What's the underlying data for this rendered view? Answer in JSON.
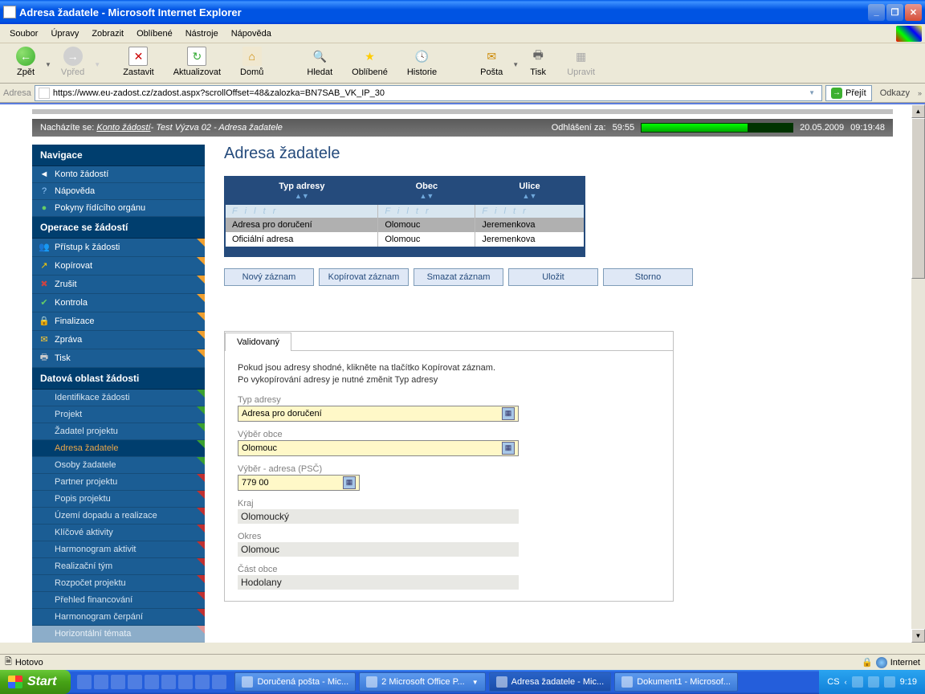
{
  "window": {
    "title": "Adresa žadatele - Microsoft Internet Explorer"
  },
  "menu": {
    "items": [
      "Soubor",
      "Úpravy",
      "Zobrazit",
      "Oblíbené",
      "Nástroje",
      "Nápověda"
    ]
  },
  "toolbar": {
    "back": "Zpět",
    "forward": "Vpřed",
    "stop": "Zastavit",
    "refresh": "Aktualizovat",
    "home": "Domů",
    "search": "Hledat",
    "favorites": "Oblíbené",
    "history": "Historie",
    "mail": "Pošta",
    "print": "Tisk",
    "edit": "Upravit"
  },
  "addressbar": {
    "label": "Adresa",
    "url": "https://www.eu-zadost.cz/zadost.aspx?scrollOffset=48&zalozka=BN7SAB_VK_IP_30",
    "go": "Přejít",
    "links": "Odkazy"
  },
  "breadcrumb": {
    "prefix": "Nacházíte se:",
    "link": "Konto žádostí",
    "trail": " - Test Výzva 02 - Adresa žadatele",
    "logout_label": "Odhlášení za:",
    "logout_time": "59:55",
    "date": "20.05.2009",
    "time": "09:19:48"
  },
  "sidebar": {
    "nav_header": "Navigace",
    "nav_items": [
      "Konto žádostí",
      "Nápověda",
      "Pokyny řídícího orgánu"
    ],
    "ops_header": "Operace se žádostí",
    "ops_items": [
      "Přístup k žádosti",
      "Kopírovat",
      "Zrušit",
      "Kontrola",
      "Finalizace",
      "Zpráva",
      "Tisk"
    ],
    "data_header": "Datová oblast žádosti",
    "data_items": [
      "Identifikace žádosti",
      "Projekt",
      "Žadatel projektu",
      "Adresa žadatele",
      "Osoby žadatele",
      "Partner projektu",
      "Popis projektu",
      "Území dopadu a realizace",
      "Klíčové aktivity",
      "Harmonogram aktivit",
      "Realizační tým",
      "Rozpočet projektu",
      "Přehled financování",
      "Harmonogram čerpání",
      "Horizontální témata"
    ]
  },
  "page": {
    "title": "Adresa žadatele",
    "table": {
      "headers": [
        "Typ adresy",
        "Obec",
        "Ulice"
      ],
      "filter": "F i l t r",
      "rows": [
        {
          "typ": "Adresa pro doručení",
          "obec": "Olomouc",
          "ulice": "Jeremenkova"
        },
        {
          "typ": "Oficiální adresa",
          "obec": "Olomouc",
          "ulice": "Jeremenkova"
        }
      ]
    },
    "buttons": {
      "novy": "Nový záznam",
      "kopirovat": "Kopírovat záznam",
      "smazat": "Smazat záznam",
      "ulozit": "Uložit",
      "storno": "Storno"
    },
    "tab": "Validovaný",
    "hint1": "Pokud jsou adresy shodné, klikněte na tlačítko Kopírovat záznam.",
    "hint2": "Po vykopírování adresy je nutné změnit Typ adresy",
    "fields": {
      "typ_label": "Typ adresy",
      "typ_value": "Adresa pro doručení",
      "obec_label": "Výběr obce",
      "obec_value": "Olomouc",
      "psc_label": "Výběr - adresa (PSČ)",
      "psc_value": "779 00",
      "kraj_label": "Kraj",
      "kraj_value": "Olomoucký",
      "okres_label": "Okres",
      "okres_value": "Olomouc",
      "cast_label": "Část obce",
      "cast_value": "Hodolany"
    }
  },
  "iestatus": {
    "text": "Hotovo",
    "zone": "Internet"
  },
  "taskbar": {
    "start": "Start",
    "items": [
      {
        "label": "Doručená pošta - Mic..."
      },
      {
        "label": "2 Microsoft Office P..."
      },
      {
        "label": "Adresa žadatele - Mic..."
      },
      {
        "label": "Dokument1 - Microsof..."
      }
    ],
    "lang": "CS",
    "clock": "9:19"
  }
}
